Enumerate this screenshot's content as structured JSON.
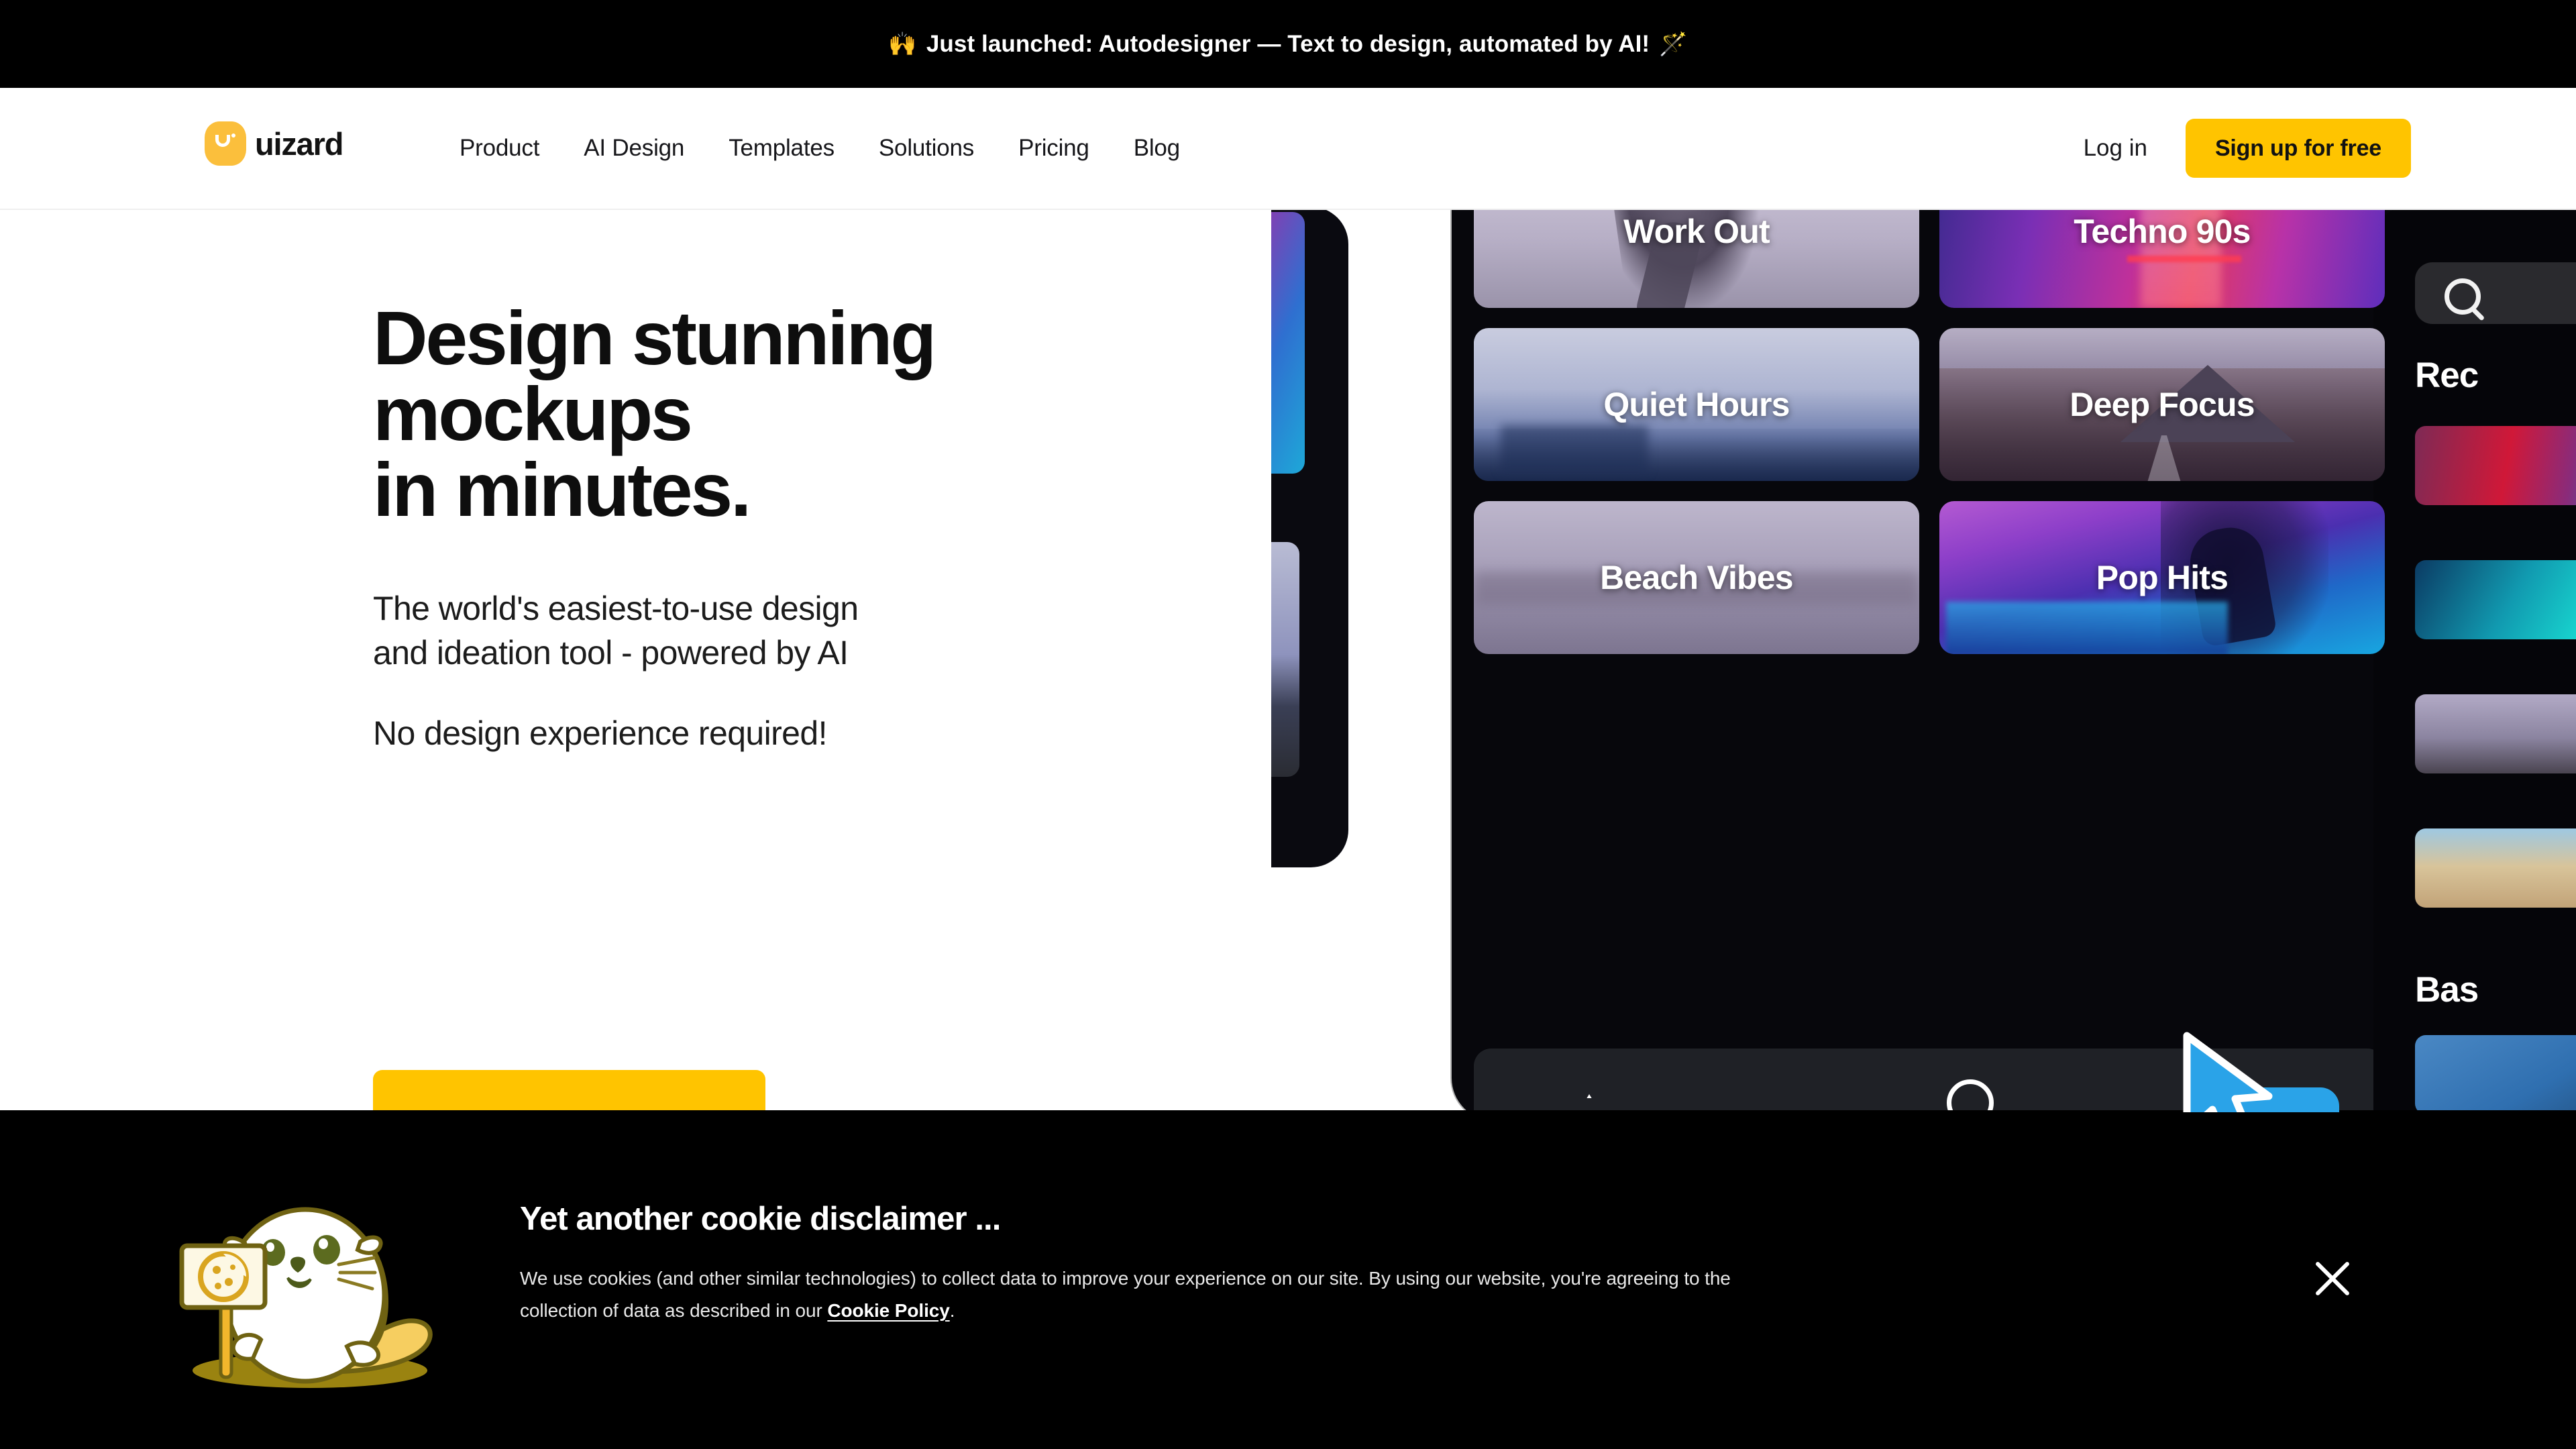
{
  "announcement": {
    "emoji_left": "🙌",
    "text": "Just launched: Autodesigner — Text to design, automated by AI!",
    "emoji_right": "🪄"
  },
  "navbar": {
    "logo_word": "uizard",
    "links": [
      {
        "label": "Product"
      },
      {
        "label": "AI Design"
      },
      {
        "label": "Templates"
      },
      {
        "label": "Solutions"
      },
      {
        "label": "Pricing"
      },
      {
        "label": "Blog"
      }
    ],
    "login_label": "Log in",
    "signup_label": "Sign up for free"
  },
  "hero": {
    "title_line1": "Design stunning",
    "title_line2": "mockups",
    "title_line3": "in minutes.",
    "subtitle_line1": "The world's easiest-to-use design",
    "subtitle_line2": "and ideation tool - powered by AI",
    "note": "No design experience required!",
    "artwork": {
      "tiles": [
        {
          "label": "Work Out"
        },
        {
          "label": "Techno 90s"
        },
        {
          "label": "Quiet Hours"
        },
        {
          "label": "Deep Focus"
        },
        {
          "label": "Beach Vibes"
        },
        {
          "label": "Pop Hits"
        }
      ],
      "right_phone": {
        "heading_recent": "Rec",
        "heading_based": "Bas"
      }
    }
  },
  "cookie": {
    "title": "Yet another cookie disclaimer ...",
    "body_part1": "We use cookies (and other similar technologies) to collect data to improve your experience on our site. By using our website, you're agreeing to the collection of data as described in our ",
    "link_label": "Cookie Policy",
    "body_part2": "."
  },
  "colors": {
    "accent_yellow": "#FFC400",
    "logo_yellow": "#FBBF3C",
    "banner_black": "#000000",
    "text_dark": "#0e0e0e",
    "cursor_blue": "#2aa3e8"
  }
}
